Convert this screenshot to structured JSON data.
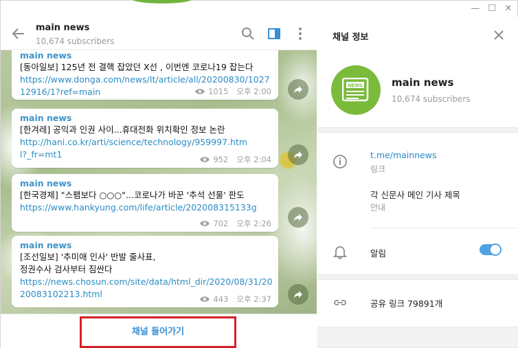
{
  "window": {
    "minimize_icon": "minimize-icon",
    "maximize_icon": "maximize-icon",
    "close_icon": "close-icon"
  },
  "chat": {
    "title": "main news",
    "subscribers": "10,674 subscribers",
    "messages": [
      {
        "author": "main news",
        "text": "[동아일보] 125년 전 결핵 잡았던 X선 , 이번엔 코로나19 잡는다",
        "link": "https://www.donga.com/news/It/article/all/20200830/102712916/1?ref=main",
        "views": "1015",
        "time": "오후 2:00"
      },
      {
        "author": "main news",
        "text": "[한겨레] 공익과 인권 사이...휴대전화 위치확인 정보 논란",
        "link": "http://hani.co.kr/arti/science/technology/959997.html?_fr=mt1",
        "views": "952",
        "time": "오후 2:04"
      },
      {
        "author": "main news",
        "text": "[한국경제] \"스팸보다 ○○○\"...코로나가 바꾼 '추석 선물' 판도",
        "link": "https://www.hankyung.com/life/article/202008315133g",
        "views": "702",
        "time": "오후 2:26"
      },
      {
        "author": "main news",
        "text": "[조선일보] '추미애 인사' 반발 줄사표,\n정권수사 검사부터 짐싼다",
        "link": "https://news.chosun.com/site/data/html_dir/2020/08/31/2020083102213.html",
        "views": "443",
        "time": "오후 2:37"
      }
    ],
    "join_label": "채널 들어가기"
  },
  "info": {
    "title": "채널 정보",
    "name": "main news",
    "subscribers": "10,674 subscribers",
    "link": "t.me/mainnews",
    "link_label": "링크",
    "description": "각 신문사 메인 기사 제목",
    "description_label": "안내",
    "notifications_label": "알림",
    "notifications_on": true,
    "share_label": "공유 링크 79891개"
  },
  "colors": {
    "accent": "#3a8fd2",
    "avatar": "#7bbb3c",
    "highlight": "#d51f26"
  }
}
